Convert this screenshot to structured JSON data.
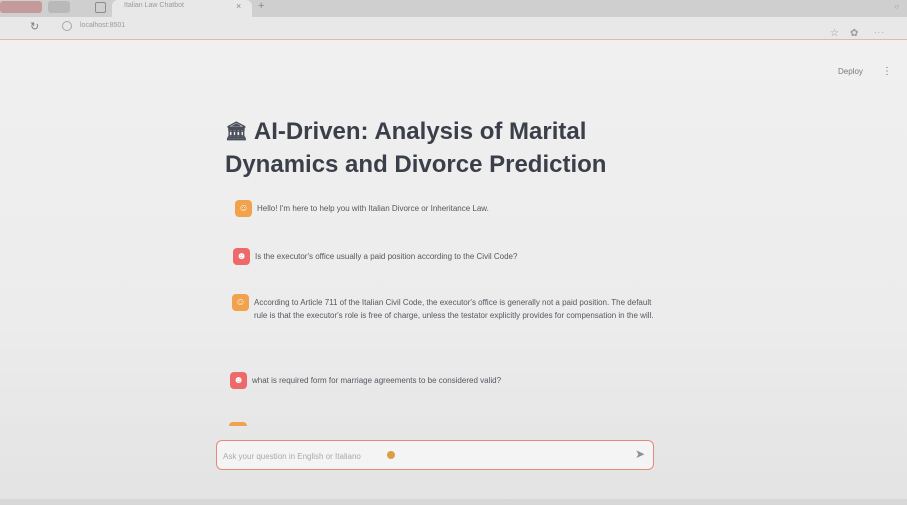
{
  "browser": {
    "tab_title": "Italian Law Chatbot",
    "tab_close": "×",
    "new_tab": "+",
    "url": "localhost:8501"
  },
  "app": {
    "deploy_label": "Deploy",
    "menu_icon": "⋮",
    "title": "AI-Driven: Analysis of Marital Dynamics and Divorce Prediction",
    "title_icon": "🏛"
  },
  "messages": [
    {
      "role": "assistant",
      "icon": "bot-icon",
      "text": "Hello! I'm here to help you with Italian Divorce or Inheritance Law."
    },
    {
      "role": "user",
      "icon": "user-icon",
      "text": "Is the executor's office usually a paid position according to the Civil Code?"
    },
    {
      "role": "assistant",
      "icon": "bot-icon",
      "text": "According to Article 711 of the Italian Civil Code, the executor's office is generally not a paid position. The default rule is that the executor's role is free of charge, unless the testator explicitly provides for compensation in the will."
    },
    {
      "role": "user",
      "icon": "user-icon",
      "text": "what is required form for marriage agreements to be considered valid?"
    }
  ],
  "chat_input": {
    "placeholder": "Ask your question in English or Italiano",
    "value": ""
  },
  "colors": {
    "assistant_avatar": "#f1a24c",
    "user_avatar": "#ee6a6a",
    "input_border": "#e58a7a"
  }
}
